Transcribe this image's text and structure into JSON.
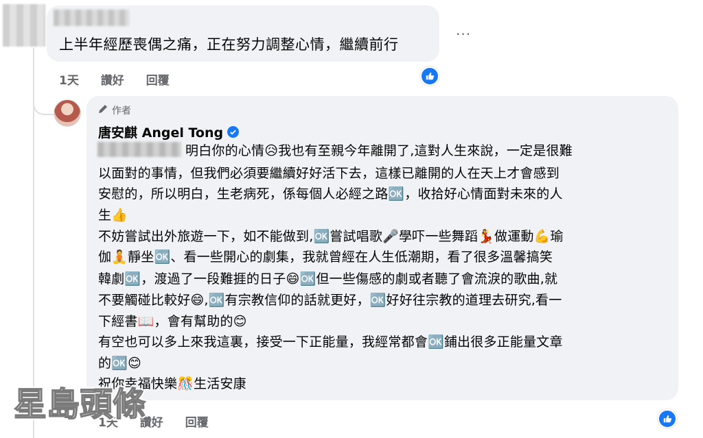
{
  "comment1": {
    "text": "上半年經歷喪偶之痛，正在努力調整心情，繼續前行",
    "more": "···",
    "time": "1天",
    "like": "讚好",
    "reply": "回覆"
  },
  "reply": {
    "author_label": "作者",
    "name": "唐安麒 Angel Tong",
    "lines": [
      "明白你的心情😥我也有至親今年離開了,這對人生來說，一定是很難",
      "以面對的事情，但我們必須要繼續好好活下去，這樣已離開的人在天上才會感到",
      "安慰的，所以明白，生老病死，係每個人必經之路🆗，收拾好心情面對未來的人",
      "生👍",
      "不妨嘗試出外旅遊一下，如不能做到,🆗嘗試唱歌🎤學吓一些舞蹈💃做運動💪瑜",
      "伽🧘靜坐🆗、看一些開心的劇集，我就曾經在人生低潮期，看了很多溫馨搞笑",
      "韓劇🆗，渡過了一段難捱的日子😄🆗但一些傷感的劇或者聽了會流淚的歌曲,就",
      "不要觸碰比較好😄,🆗有宗教信仰的話就更好，🆗好好往宗教的道理去研究,看一",
      "下經書📖，會有幫助的😊",
      "有空也可以多上來我這裏，接受一下正能量，我經常都會🆗鋪出很多正能量文章",
      "的🆗😊",
      "祝你幸福快樂🎊生活安康"
    ],
    "time": "1天",
    "like": "讚好",
    "reply": "回覆"
  },
  "watermark": "星島頭條",
  "colors": {
    "accent": "#1877f2",
    "bubble": "#f0f2f5",
    "meta": "#65676b"
  },
  "icons": [
    "pencil-icon",
    "verified-badge-icon",
    "thumbs-up-icon",
    "more-options-icon"
  ]
}
